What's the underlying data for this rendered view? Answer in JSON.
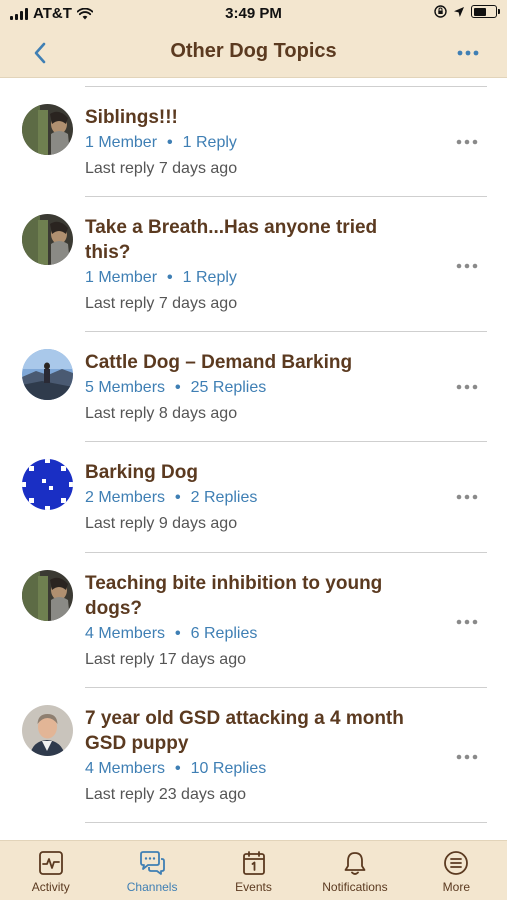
{
  "status_bar": {
    "carrier": "AT&T",
    "time": "3:49 PM",
    "battery_level": 0.6
  },
  "header": {
    "title": "Other Dog Topics",
    "back_icon": "chevron-left-icon",
    "more_icon": "more-horizontal-icon",
    "accent_color": "#3f7fb4"
  },
  "channels": [
    {
      "title": "Siblings!!!",
      "members": "1 Member",
      "replies": "1 Reply",
      "last_reply": "Last reply 7 days ago",
      "avatar": "avatar-person-with-dog"
    },
    {
      "title": "Take a Breath...Has anyone tried this?",
      "members": "1 Member",
      "replies": "1 Reply",
      "last_reply": "Last reply 7 days ago",
      "avatar": "avatar-person-with-dog"
    },
    {
      "title": "Cattle Dog – Demand Barking",
      "members": "5 Members",
      "replies": "25 Replies",
      "last_reply": "Last reply 8 days ago",
      "avatar": "avatar-mountain-view"
    },
    {
      "title": "Barking Dog",
      "members": "2 Members",
      "replies": "2 Replies",
      "last_reply": "Last reply 9 days ago",
      "avatar": "avatar-blue-pattern"
    },
    {
      "title": "Teaching bite inhibition to young dogs?",
      "members": "4 Members",
      "replies": "6 Replies",
      "last_reply": "Last reply 17 days ago",
      "avatar": "avatar-person-with-dog"
    },
    {
      "title": "7 year old GSD attacking a 4 month GSD puppy",
      "members": "4 Members",
      "replies": "10 Replies",
      "last_reply": "Last reply 23 days ago",
      "avatar": "avatar-man-portrait"
    }
  ],
  "tab_bar": {
    "active": "Channels",
    "tabs": [
      {
        "label": "Activity",
        "icon": "activity-icon"
      },
      {
        "label": "Channels",
        "icon": "chat-bubble-icon"
      },
      {
        "label": "Events",
        "icon": "calendar-icon"
      },
      {
        "label": "Notifications",
        "icon": "bell-icon"
      },
      {
        "label": "More",
        "icon": "menu-icon"
      }
    ]
  }
}
